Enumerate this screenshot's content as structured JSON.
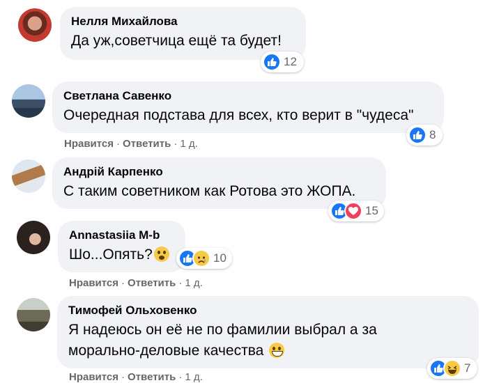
{
  "comments": [
    {
      "author": "Нелля Михайлова",
      "text": "Да уж,советчица ещё та будет!",
      "reaction_count": "12",
      "actions": null
    },
    {
      "author": "Светлана Савенко",
      "text": "Очередная подстава для всех, кто верит в \"чудеса\"",
      "reaction_count": "8",
      "actions": {
        "like": "Нравится",
        "reply": "Ответить",
        "time": "1 д."
      }
    },
    {
      "author": "Андрій Карпенко",
      "text": "С таким советником как Ротова это ЖОПА.",
      "reaction_count": "15",
      "actions": null
    },
    {
      "author": "Annastasiia M-b",
      "text": "Шо...Опять?",
      "reaction_count": "10",
      "actions": {
        "like": "Нравится",
        "reply": "Ответить",
        "time": "1 д."
      }
    },
    {
      "author": "Тимофей Ольховенко",
      "text_line1": "Я надеюсь он её не по фамилии выбрал а за",
      "text_line2": "морально-деловые качества",
      "reaction_count": "7",
      "actions": {
        "like": "Нравится",
        "reply": "Ответить",
        "time": "1 д."
      }
    }
  ],
  "separator": "·",
  "icons": {
    "like": "like-reaction-icon",
    "love": "love-reaction-icon",
    "sad": "sad-reaction-icon",
    "haha": "haha-reaction-icon"
  },
  "colors": {
    "bubble": "#f0f2f5",
    "like": "#1877f2",
    "love": "#f33e58",
    "emoji": "#f7c948",
    "meta": "#65676b"
  }
}
